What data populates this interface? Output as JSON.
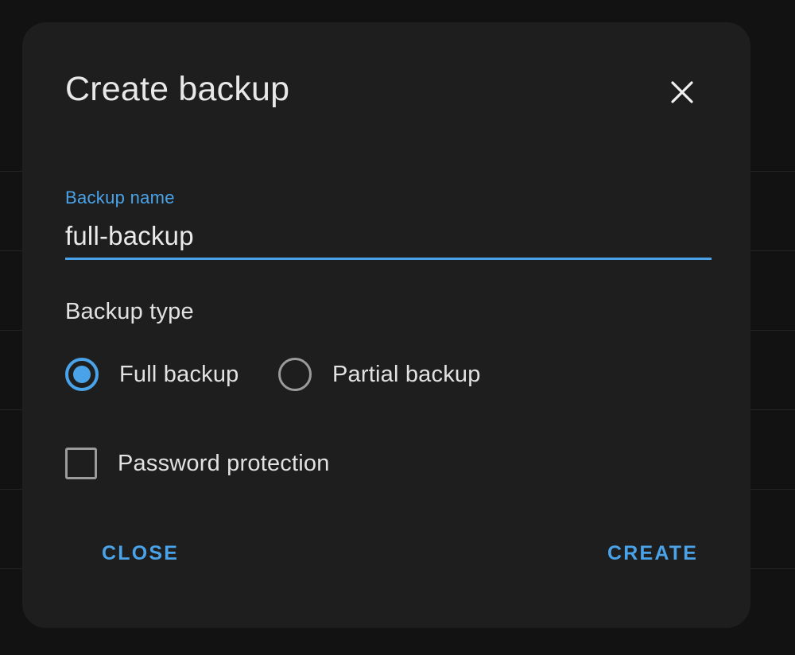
{
  "theme": {
    "page_background": "#121212",
    "dialog_surface": "#1e1e1e",
    "accent": "#4aa3e8",
    "text_primary": "#e2e2e2",
    "control_outline": "#9b9b9b",
    "divider": "#242424"
  },
  "backdrop": {
    "row_divider_positions": [
      215,
      315,
      415,
      515,
      615,
      715
    ]
  },
  "dialog": {
    "title": "Create backup",
    "close_icon": "close-icon",
    "name_field": {
      "label": "Backup name",
      "value": "full-backup",
      "placeholder": "Backup name"
    },
    "backup_type": {
      "heading": "Backup type",
      "options": [
        {
          "label": "Full backup",
          "selected": true
        },
        {
          "label": "Partial backup",
          "selected": false
        }
      ]
    },
    "password_protection": {
      "label": "Password protection",
      "checked": false
    },
    "actions": {
      "close_label": "CLOSE",
      "create_label": "CREATE"
    }
  }
}
